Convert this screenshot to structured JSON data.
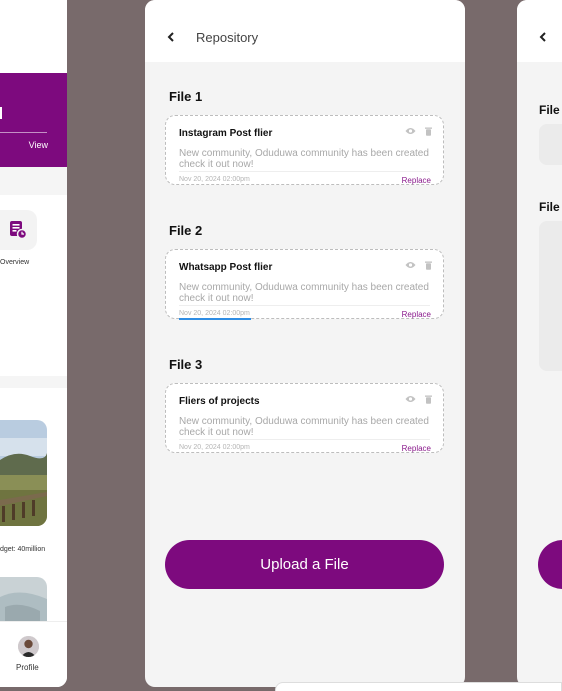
{
  "left_panel": {
    "banner_action": "View",
    "overview_label": "Overview",
    "budget_text": "dget: 40million",
    "nav_profile_label": "Profile"
  },
  "center_panel": {
    "header_title": "Repository",
    "files": [
      {
        "section_label": "File 1",
        "name": "Instagram Post flier",
        "description": "New community, Oduduwa community has been created check it out now!",
        "date": "Nov 20, 2024 02:00pm",
        "action": "Replace"
      },
      {
        "section_label": "File 2",
        "name": "Whatsapp Post flier",
        "description": "New community, Oduduwa community has been created check it out now!",
        "date": "Nov 20, 2024 02:00pm",
        "action": "Replace"
      },
      {
        "section_label": "File 3",
        "name": "Fliers of projects",
        "description": "New community, Oduduwa community has been created check it out now!",
        "date": "Nov 20, 2024 02:00pm",
        "action": "Replace"
      }
    ],
    "upload_button": "Upload a File"
  },
  "right_panel": {
    "labels": [
      "File",
      "File"
    ]
  },
  "colors": {
    "brand_purple": "#7d0a7e",
    "accent_blue": "#2f8de4",
    "background": "#786a6b",
    "card_surface": "#f4f4f4"
  },
  "icons": [
    "chevron-left-icon",
    "eye-icon",
    "trash-icon",
    "document-clock-icon",
    "avatar-icon"
  ]
}
